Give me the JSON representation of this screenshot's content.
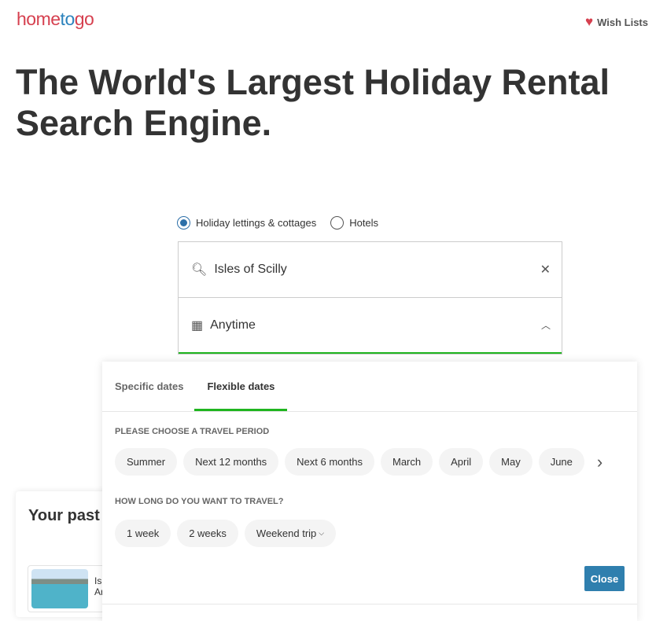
{
  "header": {
    "logo": "hometogo",
    "wish_lists": "Wish Lists"
  },
  "hero": {
    "title": "The World's Largest Holiday Rental Search Engine."
  },
  "search": {
    "types": [
      {
        "label": "Holiday lettings & cottages",
        "selected": true
      },
      {
        "label": "Hotels",
        "selected": false
      }
    ],
    "destination": "Isles of Scilly",
    "dates": "Anytime"
  },
  "past": {
    "title": "Your past",
    "item_line1": "Is",
    "item_line2": "Ar"
  },
  "popup": {
    "tabs": [
      "Specific dates",
      "Flexible dates"
    ],
    "active_tab": "Flexible dates",
    "period_label": "PLEASE CHOOSE A TRAVEL PERIOD",
    "periods": [
      "Summer",
      "Next 12 months",
      "Next 6 months",
      "March",
      "April",
      "May",
      "June"
    ],
    "duration_label": "HOW LONG DO YOU WANT TO TRAVEL?",
    "durations": [
      "1 week",
      "2 weeks",
      "Weekend trip"
    ],
    "close": "Close"
  },
  "colors": {
    "brand": "#d6404f",
    "accent": "#1fb51f",
    "button": "#2f7fae"
  }
}
